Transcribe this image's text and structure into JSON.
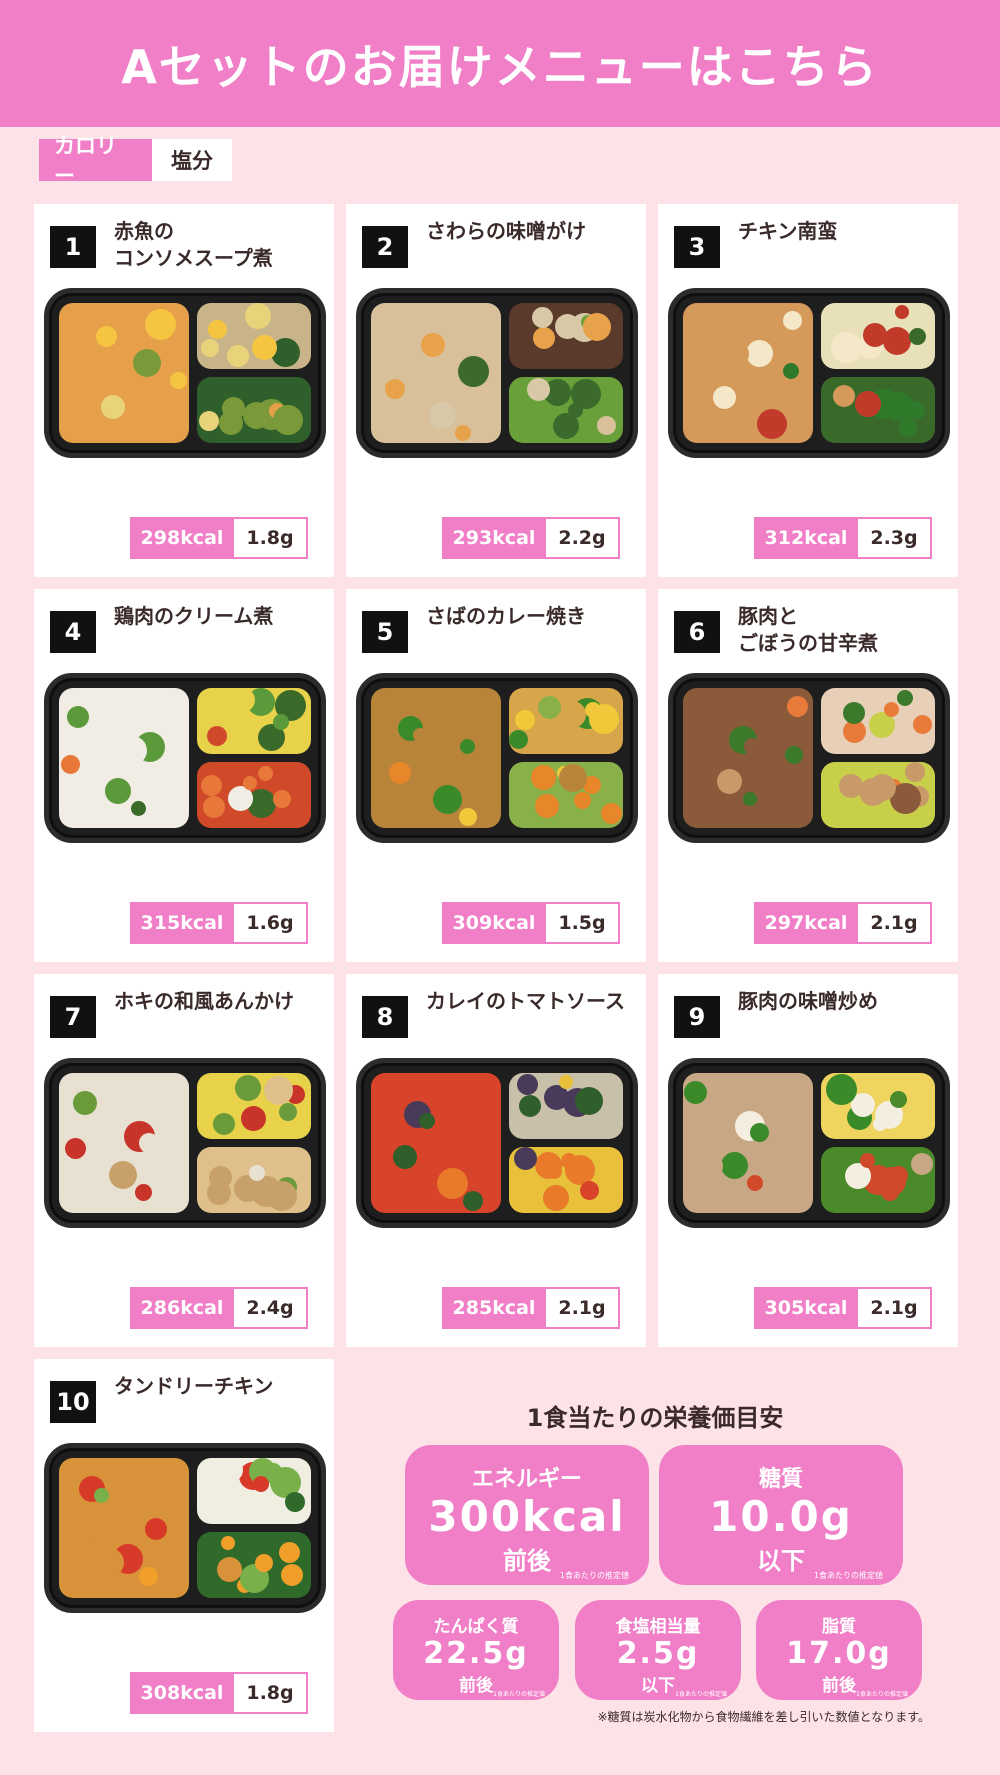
{
  "header": {
    "title": "Aセットのお届けメニューはこちら"
  },
  "toggle": {
    "calorie_label": "カロリー",
    "salt_label": "塩分"
  },
  "colors": {
    "accent": "#f07fc8",
    "background": "#fde3e7"
  },
  "menu": [
    {
      "num": "1",
      "name": "赤魚の\nコンソメスープ煮",
      "kcal": "298kcal",
      "salt": "1.8g"
    },
    {
      "num": "2",
      "name": "さわらの味噌がけ",
      "kcal": "293kcal",
      "salt": "2.2g"
    },
    {
      "num": "3",
      "name": "チキン南蛮",
      "kcal": "312kcal",
      "salt": "2.3g"
    },
    {
      "num": "4",
      "name": "鶏肉のクリーム煮",
      "kcal": "315kcal",
      "salt": "1.6g"
    },
    {
      "num": "5",
      "name": "さばのカレー焼き",
      "kcal": "309kcal",
      "salt": "1.5g"
    },
    {
      "num": "6",
      "name": "豚肉と\nごぼうの甘辛煮",
      "kcal": "297kcal",
      "salt": "2.1g"
    },
    {
      "num": "7",
      "name": "ホキの和風あんかけ",
      "kcal": "286kcal",
      "salt": "2.4g"
    },
    {
      "num": "8",
      "name": "カレイのトマトソース",
      "kcal": "285kcal",
      "salt": "2.1g"
    },
    {
      "num": "9",
      "name": "豚肉の味噌炒め",
      "kcal": "305kcal",
      "salt": "2.1g"
    },
    {
      "num": "10",
      "name": "タンドリーチキン",
      "kcal": "308kcal",
      "salt": "1.8g"
    }
  ],
  "summary": {
    "title": "1食当たりの栄養価目安",
    "energy": {
      "label": "エネルギー",
      "value": "300kcal",
      "suffix": "前後",
      "note": "1食あたりの推定値"
    },
    "carbs": {
      "label": "糖質",
      "value": "10.0g",
      "suffix": "以下",
      "note": "1食あたりの推定値"
    },
    "protein": {
      "label": "たんぱく質",
      "value": "22.5g",
      "suffix": "前後",
      "note": "1食あたりの推定値"
    },
    "salt": {
      "label": "食塩相当量",
      "value": "2.5g",
      "suffix": "以下",
      "note": "1食あたりの推定値"
    },
    "fat": {
      "label": "脂質",
      "value": "17.0g",
      "suffix": "前後",
      "note": "1食あたりの推定値"
    },
    "footnote": "※糖質は炭水化物から食物繊維を差し引いた数値となります。"
  }
}
